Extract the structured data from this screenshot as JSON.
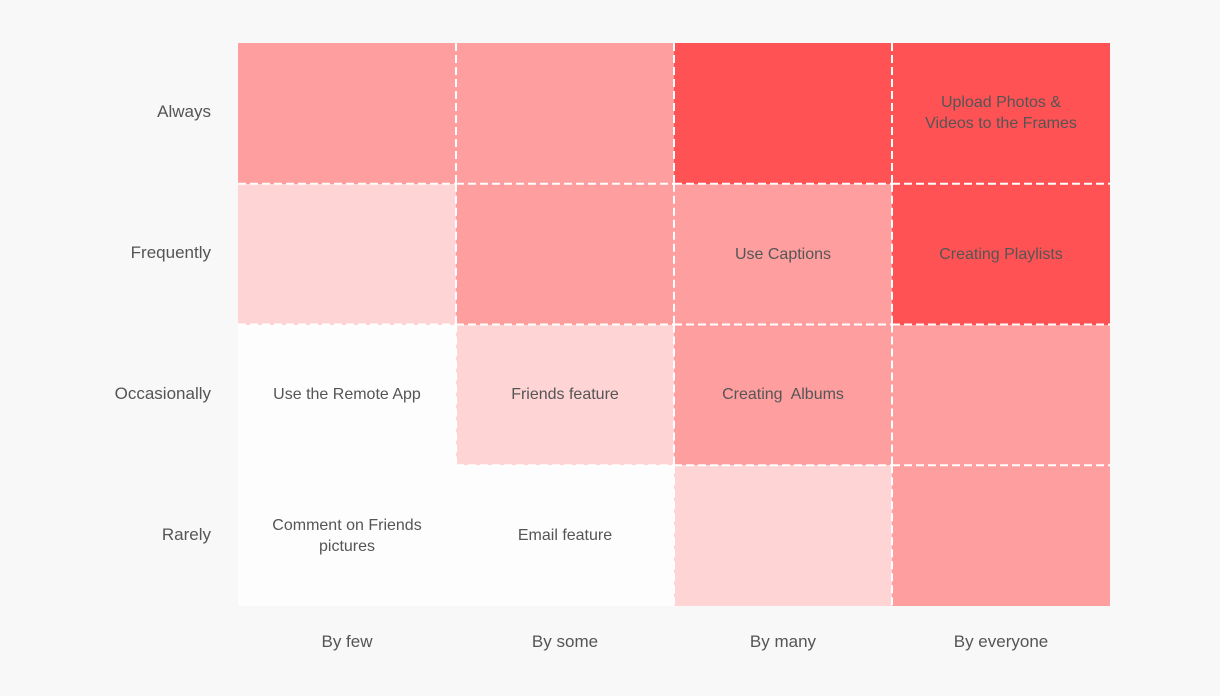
{
  "chart_data": {
    "type": "heatmap",
    "title": "",
    "xlabel": "",
    "ylabel": "",
    "x_categories": [
      "By few",
      "By some",
      "By many",
      "By everyone"
    ],
    "y_categories": [
      "Always",
      "Frequently",
      "Occasionally",
      "Rarely"
    ],
    "levels": {
      "0": "#fdfdfd",
      "1": "#ffd4d4",
      "2": "#ff9e9e",
      "3": "#ff5254"
    },
    "values": [
      [
        2,
        2,
        3,
        3
      ],
      [
        1,
        2,
        2,
        3
      ],
      [
        0,
        1,
        2,
        2
      ],
      [
        0,
        0,
        1,
        2
      ]
    ],
    "cell_labels": [
      [
        "",
        "",
        "",
        "Upload Photos & Videos to the Frames"
      ],
      [
        "",
        "",
        "Use Captions",
        "Creating Playlists"
      ],
      [
        "Use the Remote App",
        "Friends feature",
        "Creating  Albums",
        ""
      ],
      [
        "Comment on Friends pictures",
        "Email feature",
        "",
        ""
      ]
    ],
    "grid": "dashed-white",
    "legend": "none"
  },
  "colors": {
    "background": "#f8f8f8",
    "text": "#555555",
    "gridline": "#ffffff"
  }
}
